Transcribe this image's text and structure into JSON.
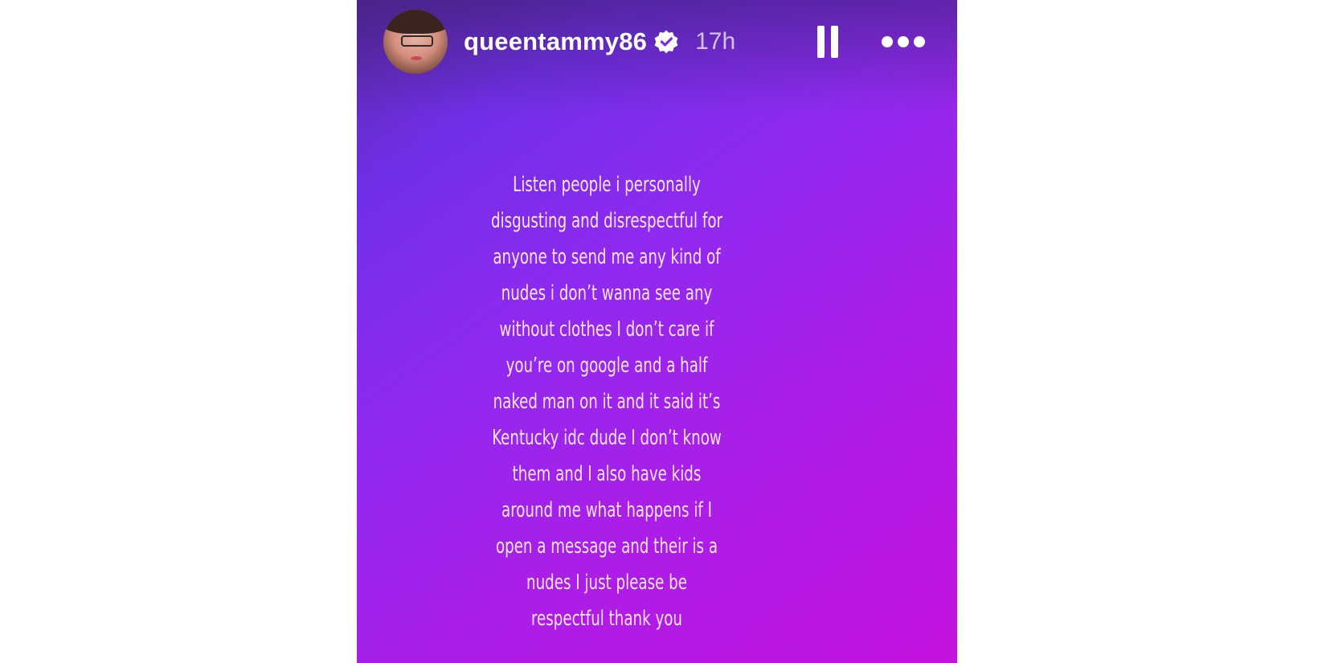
{
  "story": {
    "username": "queentammy86",
    "time_ago": "17h",
    "verified_icon": "verified-badge-icon",
    "pause_icon": "pause-icon",
    "more_icon": "more-options-icon",
    "caption_lines": [
      "Listen people i personally",
      "disgusting and disrespectful for",
      "anyone to send me any kind of",
      "nudes i don’t wanna see any",
      "without clothes I don’t care if",
      "you’re on google and a half",
      "naked man on it and it said it’s",
      "Kentucky idc dude I don’t know",
      "them and I also have kids",
      "around me what happens if I",
      "open a message and their is a",
      "nudes I just please be",
      "respectful thank you"
    ]
  },
  "colors": {
    "gradient_start": "#5a2aa8",
    "gradient_mid": "#8e2af0",
    "gradient_end": "#c412de",
    "caption_text": "#ffe3f6",
    "verified_badge": "#ffffff"
  }
}
